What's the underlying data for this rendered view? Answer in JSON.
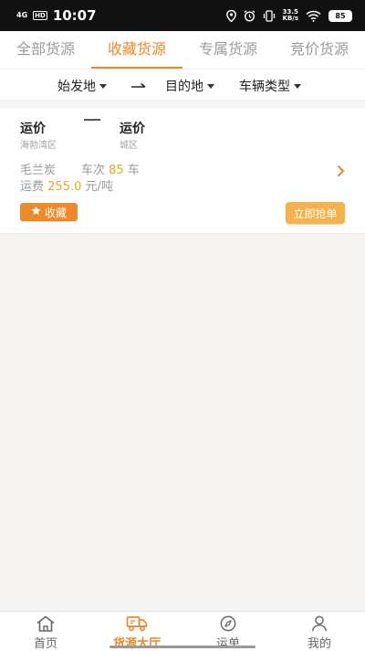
{
  "status_bar": {
    "network": "4G",
    "hd": "HD",
    "time": "10:07",
    "speed_value": "33.5",
    "speed_unit": "KB/s",
    "battery": "85"
  },
  "top_tabs": [
    {
      "label": "全部货源",
      "active": false
    },
    {
      "label": "收藏货源",
      "active": true
    },
    {
      "label": "专属货源",
      "active": false
    },
    {
      "label": "竞价货源",
      "active": false
    }
  ],
  "filters": {
    "origin": "始发地",
    "destination": "目的地",
    "vehicle_type": "车辆类型"
  },
  "cargo_card": {
    "from_label": "运价",
    "from_area": "海勃湾区",
    "to_label": "运价",
    "to_area": "城区",
    "goods": "毛兰炭",
    "trips_label": "车次",
    "trips_value": "85",
    "trips_unit": "车",
    "freight_label": "运费",
    "freight_value": "255.0",
    "freight_unit": "元/吨",
    "favorite_label": "收藏",
    "grab_label": "立即抢单"
  },
  "bottom_nav": [
    {
      "label": "首页",
      "icon": "home-icon",
      "active": false
    },
    {
      "label": "货源大厅",
      "icon": "truck-icon",
      "active": true
    },
    {
      "label": "运单",
      "icon": "compass-icon",
      "active": false
    },
    {
      "label": "我的",
      "icon": "user-icon",
      "active": false
    }
  ],
  "colors": {
    "accent": "#e8892c",
    "price": "#e8a824",
    "grab_button": "#f5b14a"
  }
}
